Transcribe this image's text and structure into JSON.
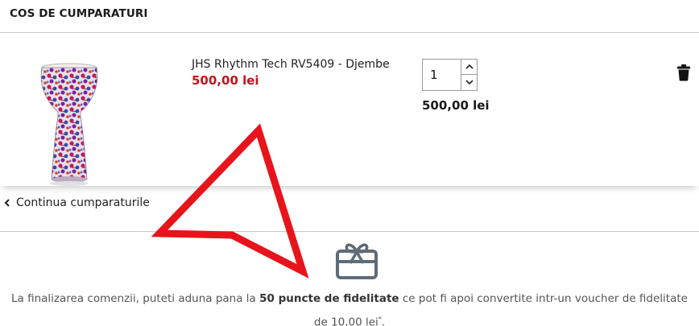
{
  "header": {
    "title": "COS DE CUMPARATURI"
  },
  "cart": {
    "items": [
      {
        "name": "JHS Rhythm Tech RV5409 - Djembe",
        "price": "500,00 lei",
        "quantity": "1",
        "line_total": "500,00 lei",
        "image_icon": "djembe-product-image",
        "delete_icon": "trash-icon"
      }
    ]
  },
  "navigation": {
    "continue_label": "Continua cumparaturile",
    "continue_icon": "chevron-left-icon"
  },
  "loyalty": {
    "icon": "gift-card-icon",
    "text_before": "La finalizarea comenzii, puteti aduna pana la ",
    "points": "50 puncte de fidelitate",
    "text_middle": " ce pot fi apoi convertite intr-un voucher de fidelitate de ",
    "voucher_value": "10,00 lei",
    "asterisk": "*",
    "text_end": "."
  },
  "annotation": {
    "arrow_color": "#e8141c"
  }
}
